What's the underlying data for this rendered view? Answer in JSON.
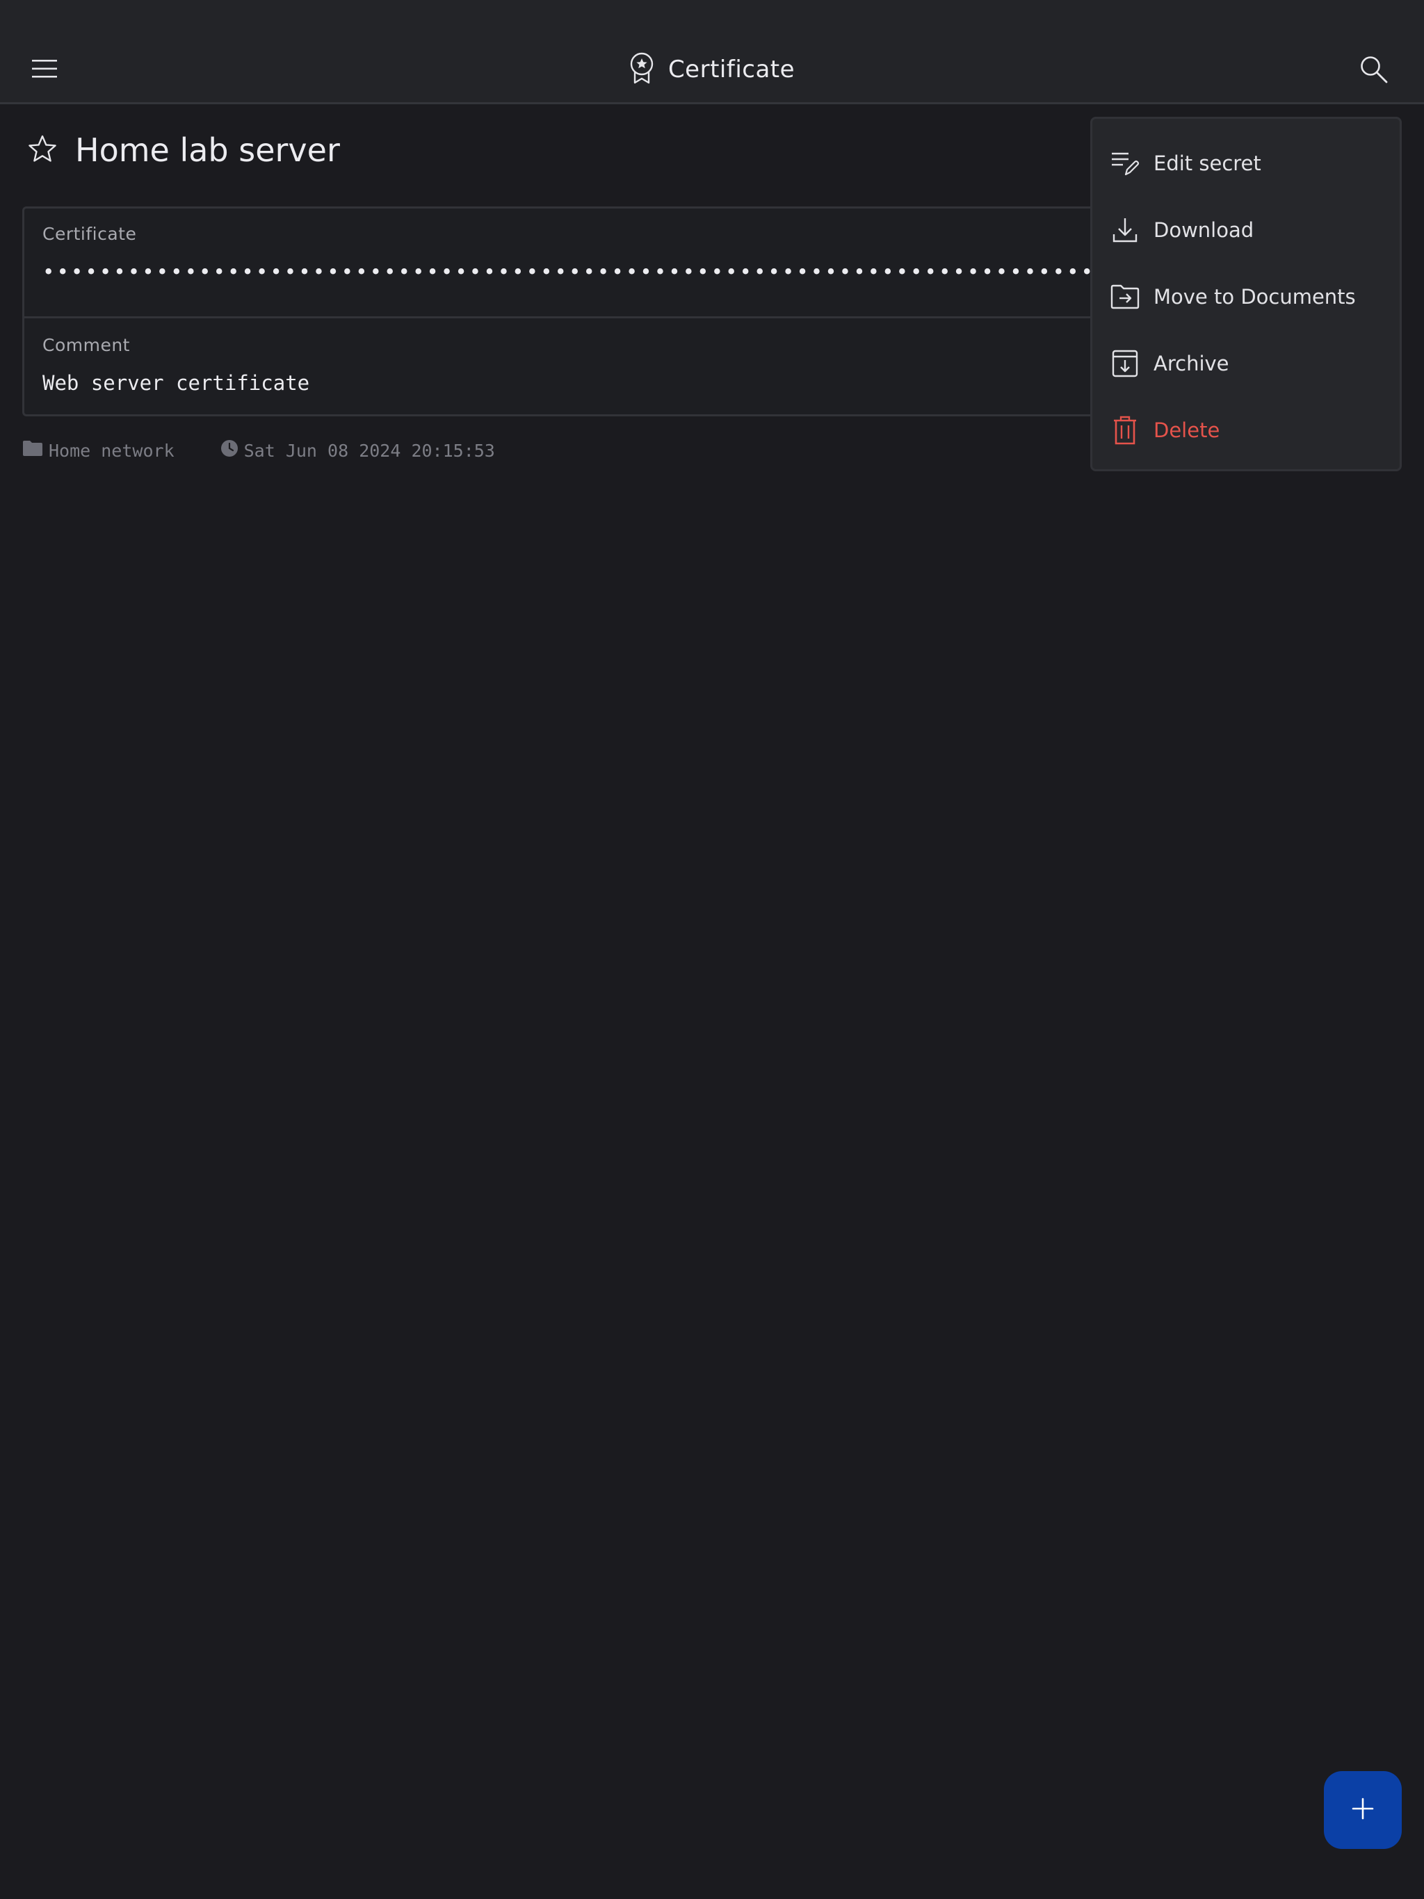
{
  "appbar": {
    "title": "Certificate",
    "title_icon": "certificate-badge-icon",
    "menu_icon": "hamburger-menu-icon",
    "search_icon": "search-icon"
  },
  "secret": {
    "title": "Home lab server",
    "favorite_icon": "star-outline-icon",
    "fields": [
      {
        "label": "Certificate",
        "value": "•••••••••••••••••••••••••••••••••••••••••••••••••••••••••••••••••••••••••••••••••••••••••••••••••••"
      },
      {
        "label": "Comment",
        "value": "Web server certificate"
      }
    ],
    "folder": "Home network",
    "folder_icon": "folder-icon",
    "timestamp": "Sat Jun 08 2024 20:15:53",
    "timestamp_icon": "clock-icon"
  },
  "menu": {
    "items": [
      {
        "label": "Edit secret",
        "icon": "edit-list-icon"
      },
      {
        "label": "Download",
        "icon": "download-icon"
      },
      {
        "label": "Move to Documents",
        "icon": "folder-move-icon"
      },
      {
        "label": "Archive",
        "icon": "archive-icon"
      },
      {
        "label": "Delete",
        "icon": "trash-icon"
      }
    ]
  },
  "fab": {
    "icon": "plus-icon"
  },
  "colors": {
    "background": "#1b1b1f",
    "appbar": "#232428",
    "menu_background": "#26272b",
    "danger": "#e5534b",
    "fab": "#0b40a6",
    "muted_text": "#7d7e86"
  }
}
